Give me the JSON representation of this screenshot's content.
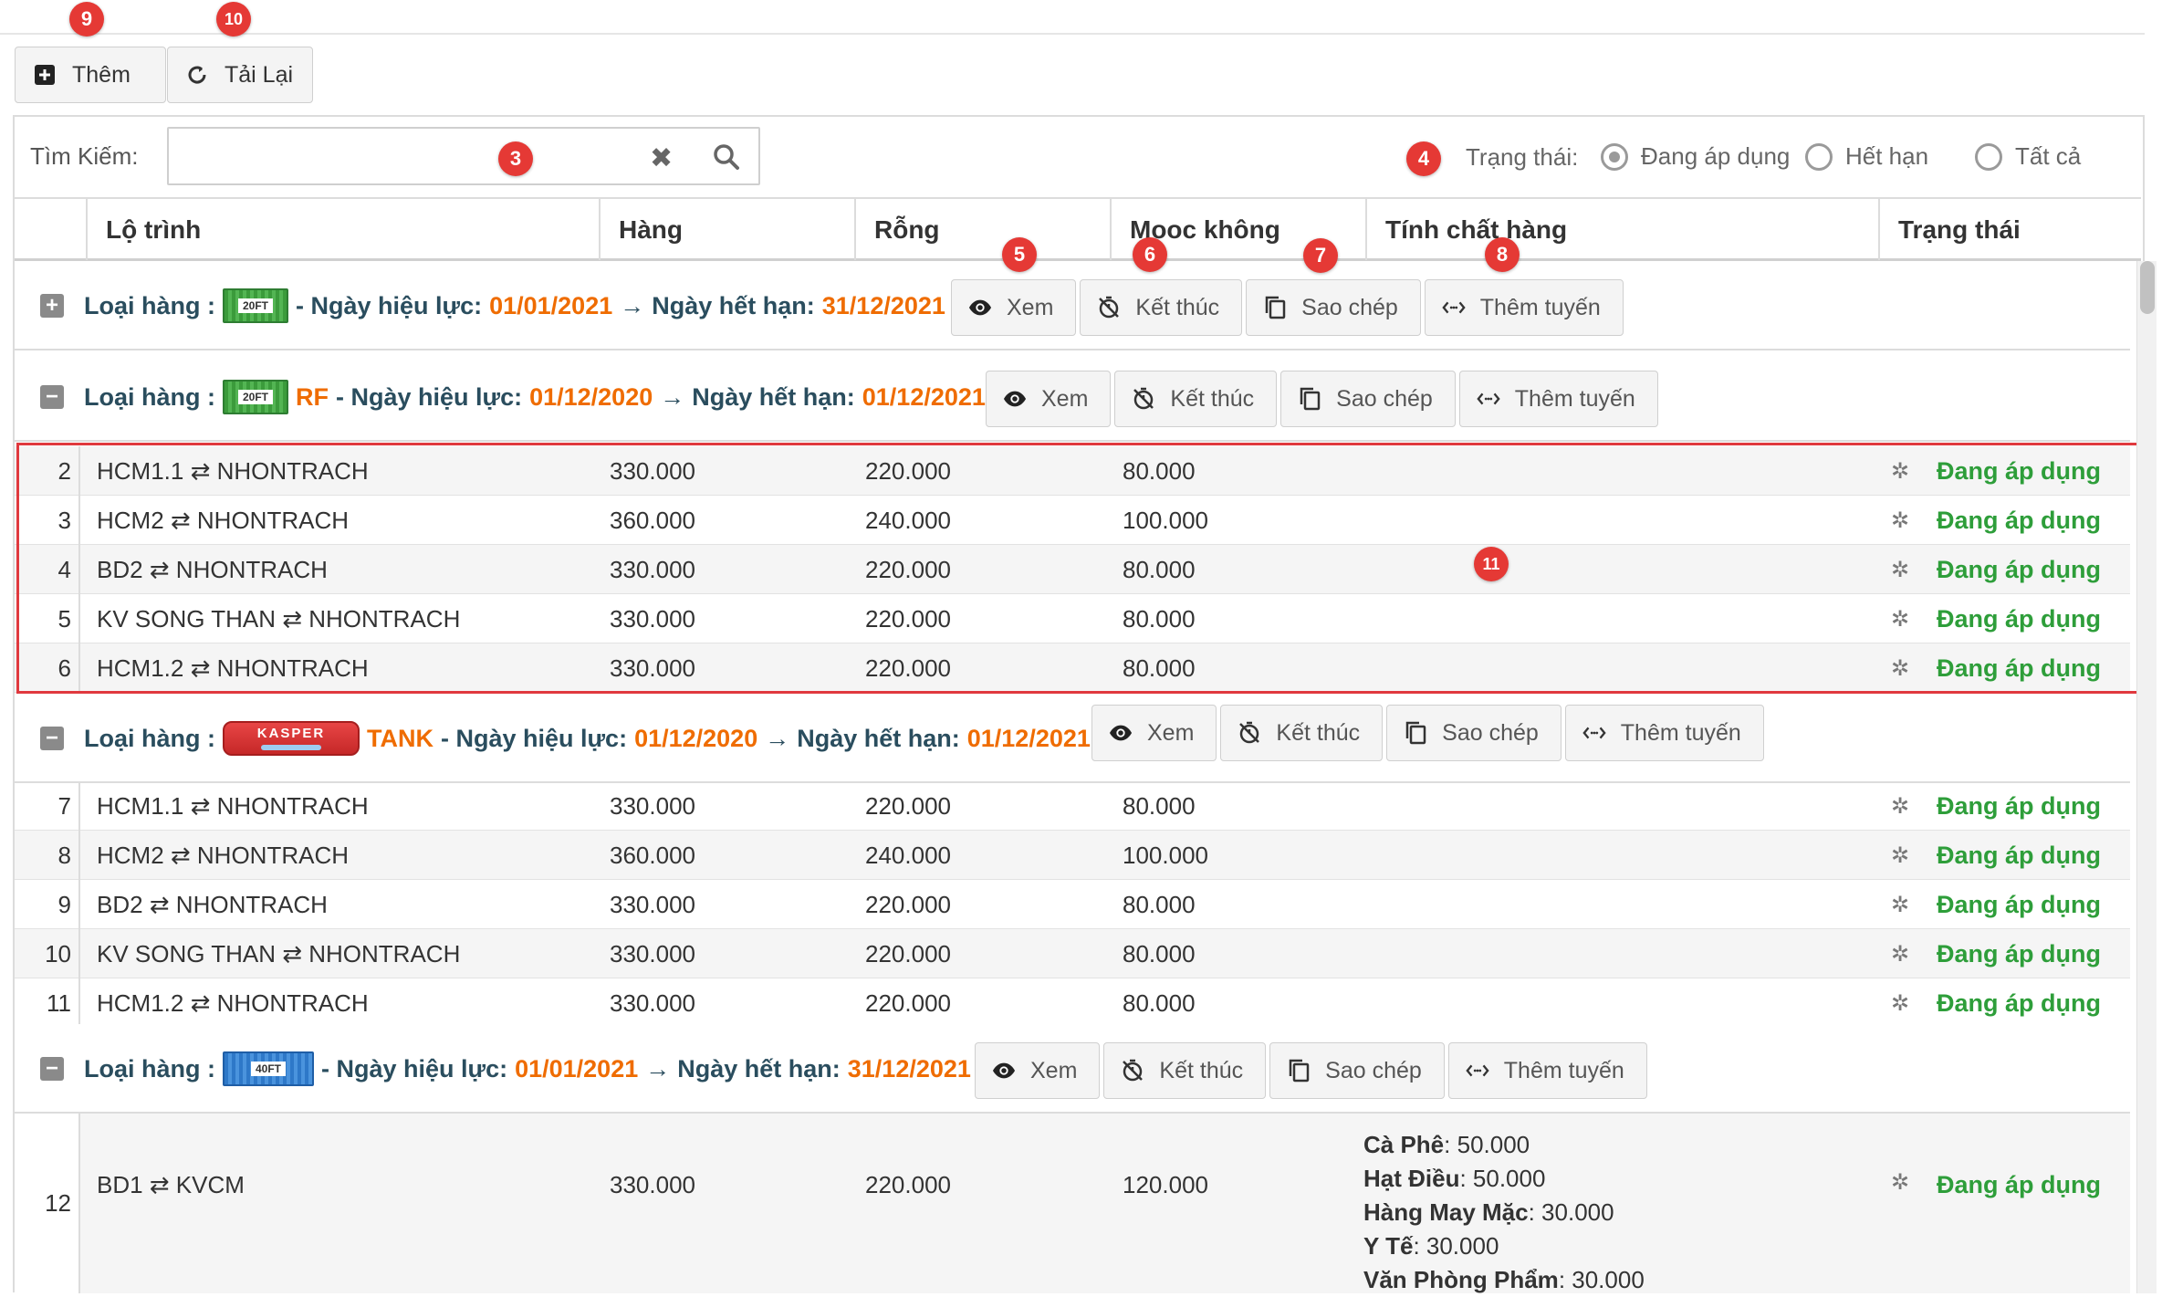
{
  "toolbar": {
    "add_label": "Thêm",
    "reload_label": "Tải Lại"
  },
  "search": {
    "label": "Tìm Kiếm:",
    "value": "",
    "placeholder": ""
  },
  "status_filter": {
    "label": "Trạng thái:",
    "options": [
      "Đang áp dụng",
      "Hết hạn",
      "Tất cả"
    ],
    "selected": "Đang áp dụng"
  },
  "columns": [
    "Lộ trình",
    "Hàng",
    "Rỗng",
    "Mooc không",
    "Tính chất hàng",
    "Trạng thái"
  ],
  "actions": {
    "view": "Xem",
    "end": "Kết thúc",
    "copy": "Sao chép",
    "add_route": "Thêm tuyến"
  },
  "groups": [
    {
      "prefix": "Loại hàng :",
      "container_icon": "container-20ft-green",
      "container_text": "20FT",
      "type_label": "",
      "effective_label": "- Ngày hiệu lực:",
      "effective_date": "01/01/2021",
      "arrow": "→",
      "expiry_label": "Ngày hết hạn:",
      "expiry_date": "31/12/2021",
      "expanded": false
    },
    {
      "prefix": "Loại hàng :",
      "container_icon": "container-20ft-green",
      "container_text": "20FT",
      "type_label": "RF",
      "effective_label": "- Ngày hiệu lực:",
      "effective_date": "01/12/2020",
      "arrow": "→",
      "expiry_label": "Ngày hết hạn:",
      "expiry_date": "01/12/2021",
      "expanded": true
    },
    {
      "prefix": "Loại hàng :",
      "container_icon": "container-tank-red",
      "container_text": "KASPER",
      "type_label": "TANK",
      "effective_label": "- Ngày hiệu lực:",
      "effective_date": "01/12/2020",
      "arrow": "→",
      "expiry_label": "Ngày hết hạn:",
      "expiry_date": "01/12/2021",
      "expanded": true
    },
    {
      "prefix": "Loại hàng :",
      "container_icon": "container-40ft-blue",
      "container_text": "40FT",
      "type_label": "",
      "effective_label": "- Ngày hiệu lực:",
      "effective_date": "01/01/2021",
      "arrow": "→",
      "expiry_label": "Ngày hết hạn:",
      "expiry_date": "31/12/2021",
      "expanded": true
    }
  ],
  "rows": [
    {
      "no": "2",
      "route": "HCM1.1 ⇄ NHONTRACH",
      "full": "330.000",
      "empty": "220.000",
      "mooc": "80.000",
      "status": "Đang áp dụng"
    },
    {
      "no": "3",
      "route": "HCM2 ⇄ NHONTRACH",
      "full": "360.000",
      "empty": "240.000",
      "mooc": "100.000",
      "status": "Đang áp dụng"
    },
    {
      "no": "4",
      "route": "BD2 ⇄ NHONTRACH",
      "full": "330.000",
      "empty": "220.000",
      "mooc": "80.000",
      "status": "Đang áp dụng"
    },
    {
      "no": "5",
      "route": "KV SONG THAN ⇄ NHONTRACH",
      "full": "330.000",
      "empty": "220.000",
      "mooc": "80.000",
      "status": "Đang áp dụng"
    },
    {
      "no": "6",
      "route": "HCM1.2 ⇄ NHONTRACH",
      "full": "330.000",
      "empty": "220.000",
      "mooc": "80.000",
      "status": "Đang áp dụng"
    },
    {
      "no": "7",
      "route": "HCM1.1 ⇄ NHONTRACH",
      "full": "330.000",
      "empty": "220.000",
      "mooc": "80.000",
      "status": "Đang áp dụng"
    },
    {
      "no": "8",
      "route": "HCM2 ⇄ NHONTRACH",
      "full": "360.000",
      "empty": "240.000",
      "mooc": "100.000",
      "status": "Đang áp dụng"
    },
    {
      "no": "9",
      "route": "BD2 ⇄ NHONTRACH",
      "full": "330.000",
      "empty": "220.000",
      "mooc": "80.000",
      "status": "Đang áp dụng"
    },
    {
      "no": "10",
      "route": "KV SONG THAN ⇄ NHONTRACH",
      "full": "330.000",
      "empty": "220.000",
      "mooc": "80.000",
      "status": "Đang áp dụng"
    },
    {
      "no": "11",
      "route": "HCM1.2 ⇄ NHONTRACH",
      "full": "330.000",
      "empty": "220.000",
      "mooc": "80.000",
      "status": "Đang áp dụng"
    }
  ],
  "last_row": {
    "no": "12",
    "route": "BD1 ⇄ KVCM",
    "full": "330.000",
    "empty": "220.000",
    "mooc": "120.000",
    "status": "Đang áp dụng",
    "properties": [
      {
        "name": "Cà Phê",
        "value": ": 50.000"
      },
      {
        "name": "Hạt Điều",
        "value": ": 50.000"
      },
      {
        "name": "Hàng May Mặc",
        "value": ": 30.000"
      },
      {
        "name": "Y Tế",
        "value": ": 30.000"
      },
      {
        "name": "Văn Phòng Phẩm",
        "value": ": 30.000"
      }
    ]
  },
  "callouts": [
    "9",
    "10",
    "3",
    "4",
    "5",
    "6",
    "7",
    "8",
    "11"
  ],
  "colors": {
    "callout": "#e53935",
    "date": "#ef6c00",
    "status_active": "#2e9e3a",
    "group_text": "#2a4d5e"
  }
}
